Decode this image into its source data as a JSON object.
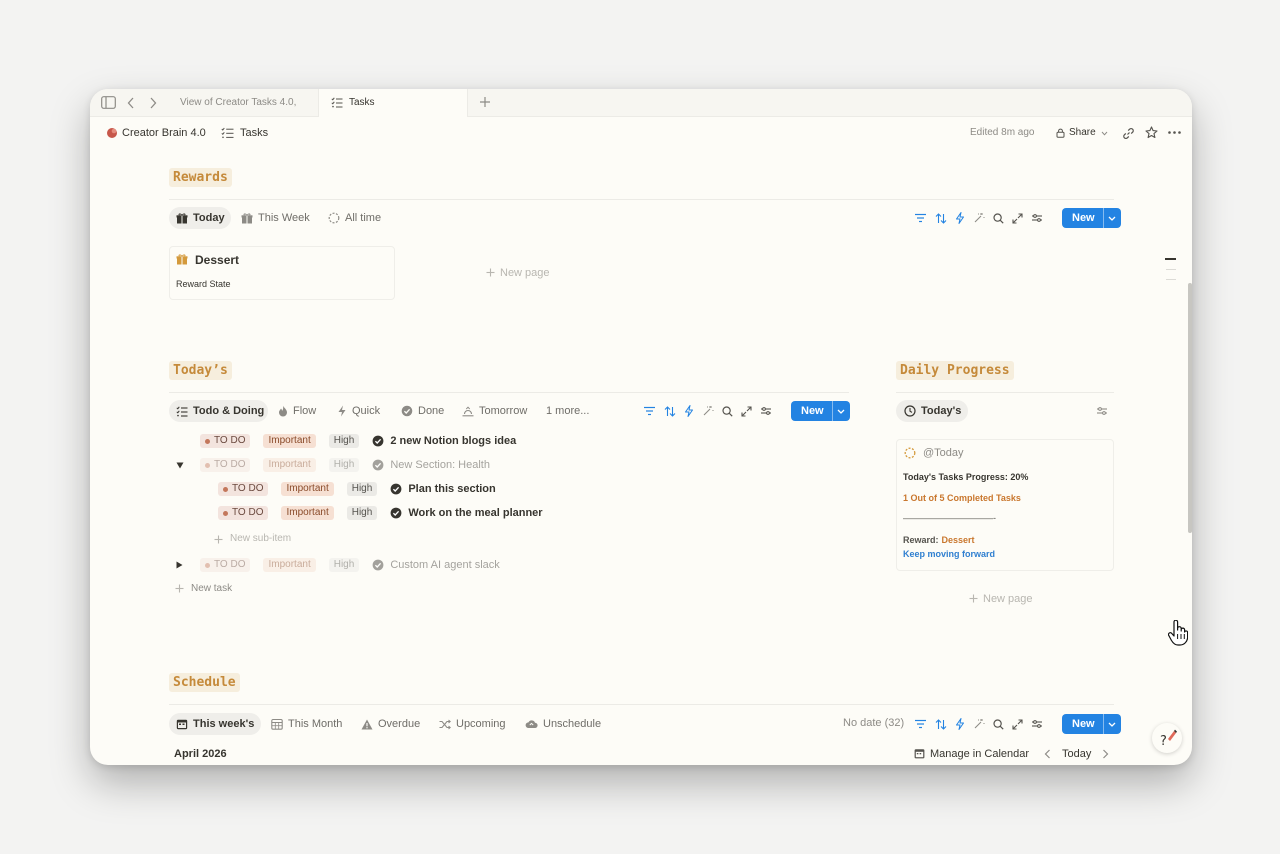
{
  "tabs": {
    "tab1": "View of Creator Tasks 4.0,",
    "tab2": "Tasks"
  },
  "header": {
    "workspace": "Creator Brain 4.0",
    "page": "Tasks",
    "edited": "Edited 8m ago",
    "share": "Share"
  },
  "rewards": {
    "heading": "Rewards",
    "tabs": [
      "Today",
      "This Week",
      "All time"
    ],
    "new_label": "New",
    "card_title": "Dessert",
    "card_prop": "Reward State",
    "new_page": "New page"
  },
  "todays": {
    "heading": "Today’s",
    "tabs": [
      "Todo & Doing",
      "Flow",
      "Quick",
      "Done",
      "Tomorrow",
      "1 more..."
    ],
    "new_label": "New",
    "tasks": [
      {
        "status": "TO DO",
        "priority": "Important",
        "level": "High",
        "title": "2 new Notion blogs idea"
      },
      {
        "status": "TO DO",
        "priority": "Important",
        "level": "High",
        "title": "New Section: Health"
      },
      {
        "status": "TO DO",
        "priority": "Important",
        "level": "High",
        "title": "Plan this section"
      },
      {
        "status": "TO DO",
        "priority": "Important",
        "level": "High",
        "title": "Work on the meal planner"
      },
      {
        "status": "TO DO",
        "priority": "Important",
        "level": "High",
        "title": "Custom AI agent slack"
      }
    ],
    "new_sub_item": "New sub-item",
    "new_task": "New task"
  },
  "daily_progress": {
    "heading": "Daily Progress",
    "tab": "Today's",
    "card_title": "@Today",
    "progress_line": "Today's Tasks Progress: 20%",
    "completed_line": "1 Out of 5 Completed Tasks",
    "divider_line": "——————————-",
    "reward_label": "Reward:",
    "reward_value": "Dessert",
    "keep_moving": "Keep moving forward",
    "new_page": "New page"
  },
  "schedule": {
    "heading": "Schedule",
    "tabs": [
      "This week's",
      "This Month",
      "Overdue",
      "Upcoming",
      "Unschedule"
    ],
    "no_date": "No date (32)",
    "new_label": "New",
    "month": "April 2026",
    "manage": "Manage in Calendar",
    "today": "Today"
  },
  "colors": {
    "accent": "#2383e2",
    "heading": "#c58a3a",
    "progress_orange": "#c9772e",
    "link_blue": "#2f7fd0"
  }
}
